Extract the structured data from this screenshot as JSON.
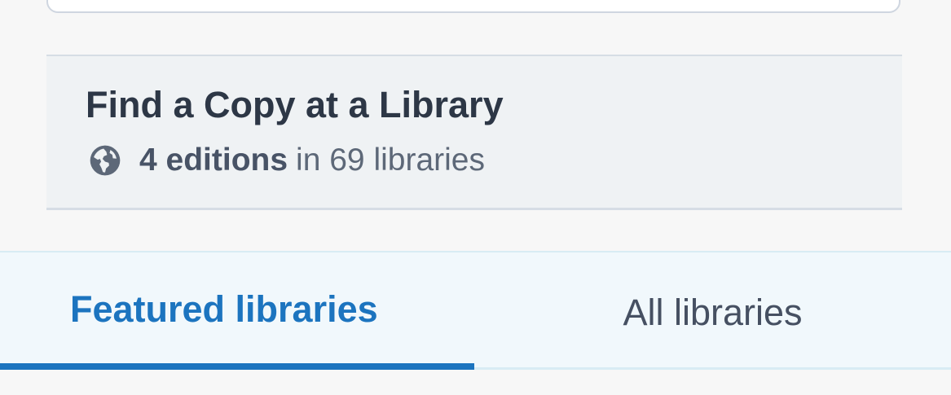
{
  "find_copy": {
    "title": "Find a Copy at a Library",
    "editions_count": "4 editions",
    "libraries_text": "in 69 libraries",
    "icon": "globe-icon"
  },
  "tabs": [
    {
      "label": "Featured libraries",
      "active": true
    },
    {
      "label": "All libraries",
      "active": false
    }
  ],
  "colors": {
    "accent": "#1c74bf",
    "panel_bg": "#eff2f4",
    "tab_bg": "#f1f8fc"
  }
}
